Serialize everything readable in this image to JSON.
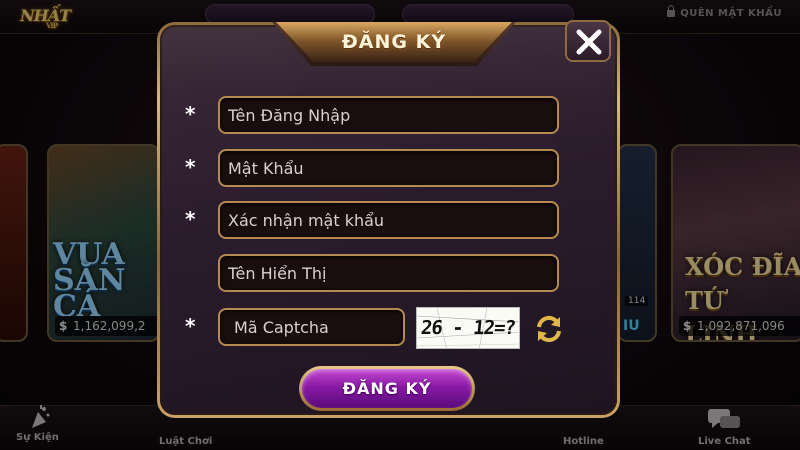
{
  "lobby": {
    "logo_text": "NHẤT",
    "logo_sub": "VIP",
    "forgot_password": "QUÊN MẬT KHẨU",
    "cards": {
      "left_title": "VUA SĂN CÁ",
      "left_jackpot": "1,162,099,2",
      "right_title": "XÓC ĐĨA TỨ LINH",
      "right_jackpot": "1,092,871,096",
      "right_partial_value": "114",
      "right_partial_label": "IU"
    },
    "bottom_nav": {
      "events": "Sự Kiện",
      "rules": "Luật Chơi",
      "hotline": "Hotline",
      "live_chat": "Live Chat"
    }
  },
  "modal": {
    "title": "ĐĂNG KÝ",
    "required_mark": "*",
    "fields": {
      "username": {
        "placeholder": "Tên Đăng Nhập",
        "value": ""
      },
      "password": {
        "placeholder": "Mật Khẩu",
        "value": ""
      },
      "confirm_password": {
        "placeholder": "Xác nhận mật khẩu",
        "value": ""
      },
      "display_name": {
        "placeholder": "Tên Hiển Thị",
        "value": ""
      },
      "captcha": {
        "placeholder": "Mã Captcha",
        "value": ""
      }
    },
    "captcha_text": "26 - 12=?",
    "submit_label": "ĐĂNG KÝ"
  },
  "icons": {
    "close": "close-icon",
    "refresh": "refresh-icon",
    "lock": "lock-icon",
    "events": "party-popper-icon",
    "chat": "chat-bubble-icon"
  },
  "colors": {
    "gold_border": "#b58a52",
    "submit_purple": "#8a1aa6",
    "field_bg": "#1a0d0f",
    "refresh_gold": "#e0b646"
  }
}
